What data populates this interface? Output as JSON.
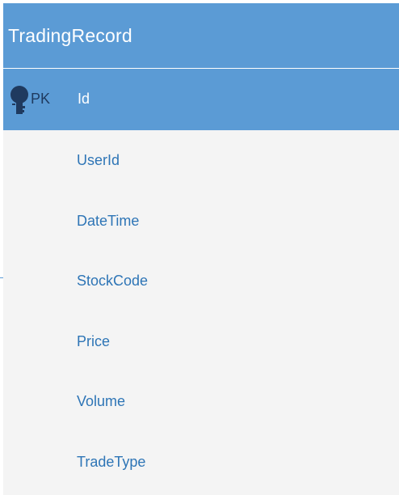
{
  "entity": {
    "title": "TradingRecord",
    "primary_key": {
      "badge": "PK",
      "name": "Id"
    },
    "fields": [
      "UserId",
      "DateTime",
      "StockCode",
      "Price",
      "Volume",
      "TradeType"
    ]
  },
  "colors": {
    "header": "#5b9bd5",
    "body": "#f4f4f4",
    "field_text": "#2e75b6",
    "key_icon": "#1f3a5f"
  }
}
